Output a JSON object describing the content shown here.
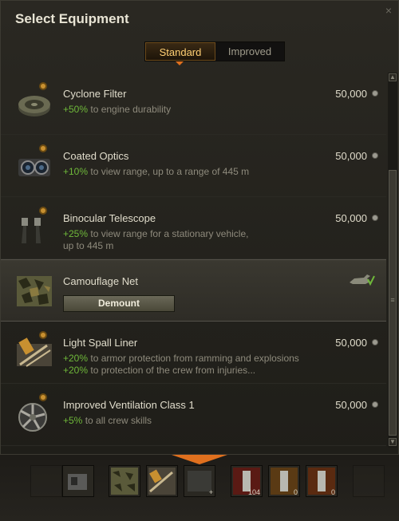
{
  "dialog": {
    "title": "Select Equipment",
    "close_glyph": "×"
  },
  "tabs": [
    {
      "label": "Standard",
      "active": true
    },
    {
      "label": "Improved",
      "active": false
    }
  ],
  "items": [
    {
      "name": "Cyclone Filter",
      "bonus": "+50%",
      "desc": " to engine durability",
      "price": "50,000",
      "icon": "cyclone-filter-icon"
    },
    {
      "name": "Coated Optics",
      "bonus": "+10%",
      "desc": " to view range, up to a range of 445 m",
      "price": "50,000",
      "icon": "coated-optics-icon"
    },
    {
      "name": "Binocular Telescope",
      "bonus": "+25%",
      "desc": " to view range for a stationary vehicle,",
      "desc2": "up to 445 m",
      "price": "50,000",
      "icon": "binocular-telescope-icon"
    },
    {
      "name": "Camouflage Net",
      "button": "Demount",
      "icon": "camouflage-net-icon",
      "mounted": true
    },
    {
      "name": "Light Spall Liner",
      "bonus": "+20%",
      "desc": " to armor protection from ramming and explosions",
      "bonus2": "+20%",
      "desc2": " to protection of the crew from injuries...",
      "price": "50,000",
      "icon": "spall-liner-icon"
    },
    {
      "name": "Improved Ventilation Class 1",
      "bonus": "+5%",
      "desc": " to all crew skills",
      "price": "50,000",
      "icon": "ventilation-icon"
    }
  ],
  "slots": {
    "plus": "+",
    "ammo": [
      "104",
      "0",
      "0"
    ]
  },
  "colors": {
    "accent": "#e0701e",
    "bonus": "#6fb83a"
  }
}
